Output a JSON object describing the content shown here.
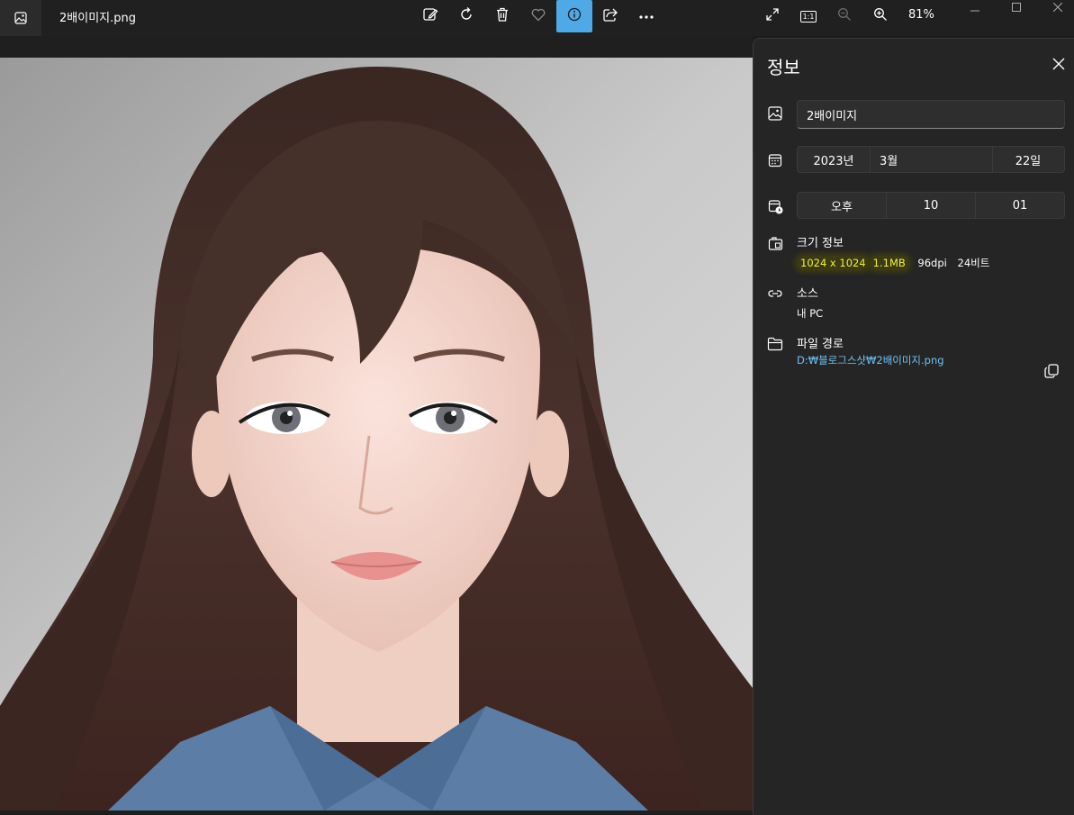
{
  "window": {
    "file_title": "2배이미지.png",
    "zoom": "81%",
    "one_to_one": "1:1"
  },
  "toolbar": {
    "icons": [
      "edit-icon",
      "rotate-icon",
      "delete-icon",
      "favorite-icon",
      "info-icon",
      "share-icon",
      "more-icon"
    ],
    "active": "info-icon"
  },
  "panel": {
    "title": "정보",
    "name": "2배이미지",
    "date": {
      "year": "2023년",
      "month": "3월",
      "day": "22일"
    },
    "time": {
      "ampm": "오후",
      "hour": "10",
      "minute": "01"
    },
    "size_heading": "크기 정보",
    "dimensions": "1024 x 1024",
    "file_size": "1.1MB",
    "dpi": "96dpi",
    "bit_depth": "24비트",
    "source_heading": "소스",
    "source_value": "내 PC",
    "path_heading": "파일 경로",
    "path_value": "D:₩블로그스샷₩2배이미지.png"
  },
  "colors": {
    "accent": "#4ea9e6",
    "highlight": "#f3ef3f",
    "link": "#6fc1f2",
    "panel_bg": "#252525"
  }
}
